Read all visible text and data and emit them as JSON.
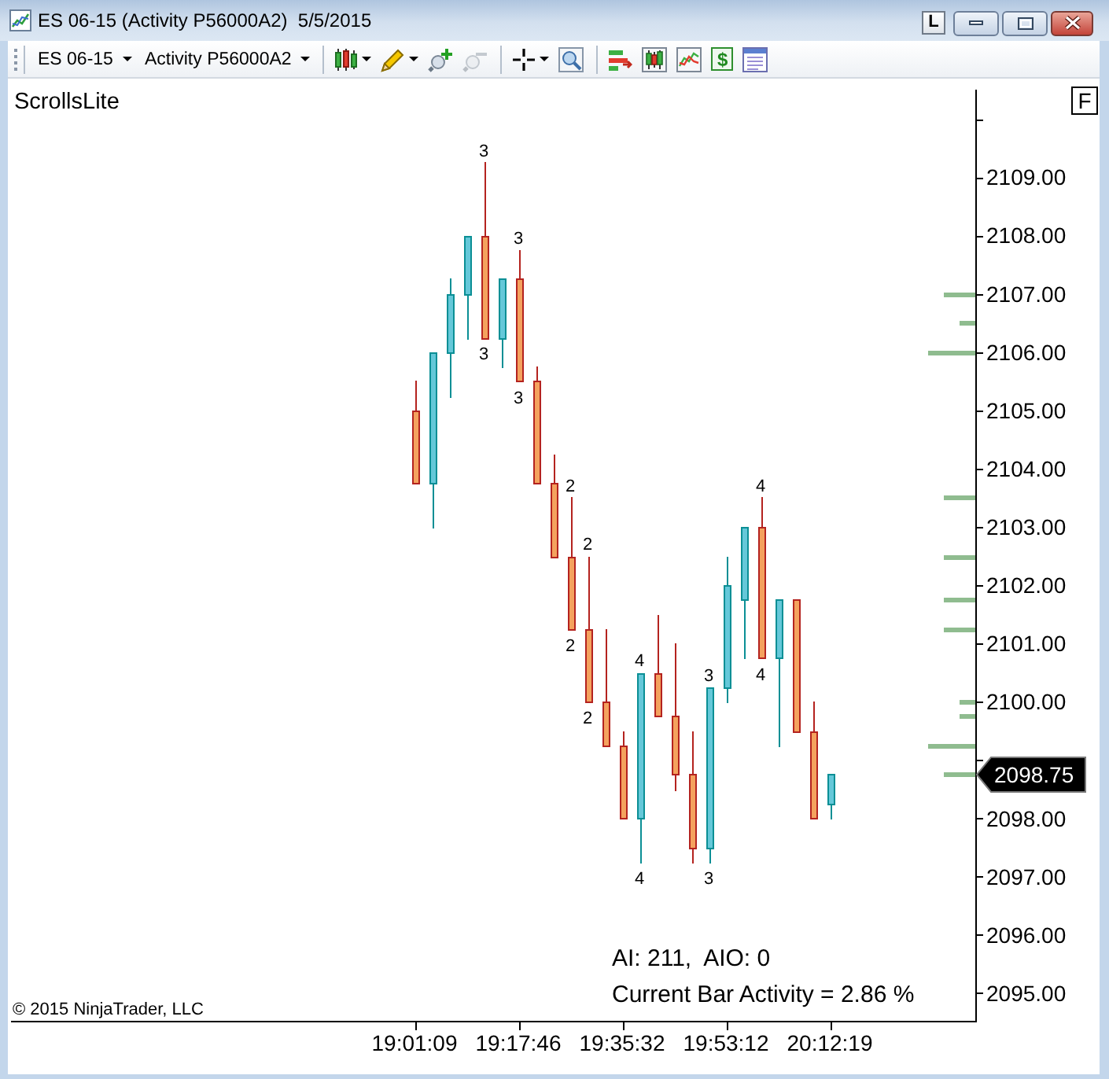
{
  "title_bar": {
    "title": "ES 06-15 (Activity P56000A2)  5/5/2015",
    "pin_button": "L"
  },
  "toolbar": {
    "selectors": [
      {
        "label": "ES 06-15"
      },
      {
        "label": "Activity P56000A2"
      }
    ],
    "tool_groups": [
      [
        {
          "kind": "style",
          "menu": true,
          "disabled": false
        },
        {
          "kind": "pencil",
          "menu": true,
          "disabled": false
        },
        {
          "kind": "zoomin",
          "menu": false,
          "disabled": false
        },
        {
          "kind": "zoomout",
          "menu": false,
          "disabled": true
        }
      ],
      [
        {
          "kind": "crosshair",
          "menu": true,
          "disabled": false
        },
        {
          "kind": "magnifier",
          "menu": false,
          "disabled": false
        }
      ],
      [
        {
          "kind": "series",
          "menu": false,
          "disabled": false
        },
        {
          "kind": "candles",
          "menu": false,
          "disabled": false
        },
        {
          "kind": "indicator",
          "menu": false,
          "disabled": false
        },
        {
          "kind": "dollar",
          "glyph": "$",
          "menu": false,
          "disabled": false
        },
        {
          "kind": "panel",
          "menu": false,
          "disabled": false
        }
      ]
    ]
  },
  "chart": {
    "indicator_label": "ScrollsLite",
    "f_button": "F",
    "price_axis_labels": [
      "2109.00",
      "2108.00",
      "2107.00",
      "2106.00",
      "2105.00",
      "2104.00",
      "2103.00",
      "2102.00",
      "2101.00",
      "2100.00",
      "2098.00",
      "2097.00",
      "2096.00",
      "2095.00"
    ],
    "bar_count_labels": [
      "3",
      "3",
      "3",
      "3",
      "2",
      "2",
      "2",
      "2",
      "4",
      "4",
      "3",
      "3",
      "4",
      "4"
    ],
    "last_price": "2098.75",
    "stats": [
      "AI: 211,  AIO: 0",
      "Current Bar Activity = 2.86 %"
    ],
    "copyright": "© 2015 NinjaTrader, LLC",
    "time_axis_labels": [
      "19:01:09",
      "19:17:46",
      "19:35:32",
      "19:53:12",
      "20:12:19"
    ]
  }
}
